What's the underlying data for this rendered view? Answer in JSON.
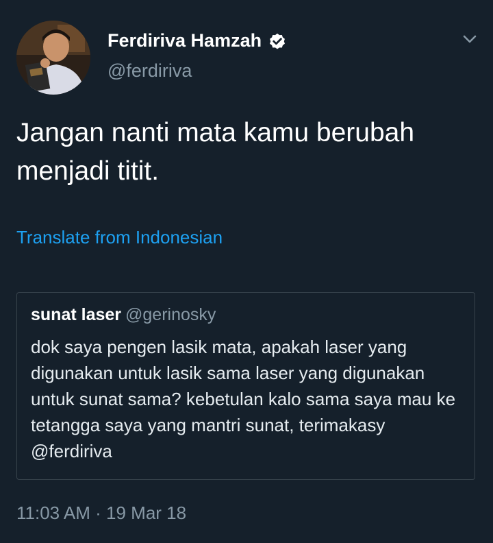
{
  "author": {
    "name": "Ferdiriva Hamzah",
    "handle": "@ferdiriva",
    "verified": true,
    "avatar_icon": "profile-photo"
  },
  "tweet": {
    "text": "Jangan nanti mata kamu berubah menjadi titit.",
    "translate_label": "Translate from Indonesian",
    "timestamp": "11:03 AM · 19 Mar 18"
  },
  "quoted_tweet": {
    "name": "sunat laser",
    "handle": "@gerinosky",
    "text": "dok saya pengen lasik mata, apakah laser yang digunakan untuk lasik sama laser yang digunakan untuk sunat sama? kebetulan kalo sama saya mau ke tetangga saya yang mantri sunat, terimakasy @ferdiriva"
  },
  "icons": {
    "verified": "verified-badge-icon",
    "menu": "chevron-down-icon"
  },
  "colors": {
    "background": "#15202b",
    "text_primary": "#ffffff",
    "text_secondary": "#8899a6",
    "link": "#1da1f2",
    "border": "#38444d"
  }
}
